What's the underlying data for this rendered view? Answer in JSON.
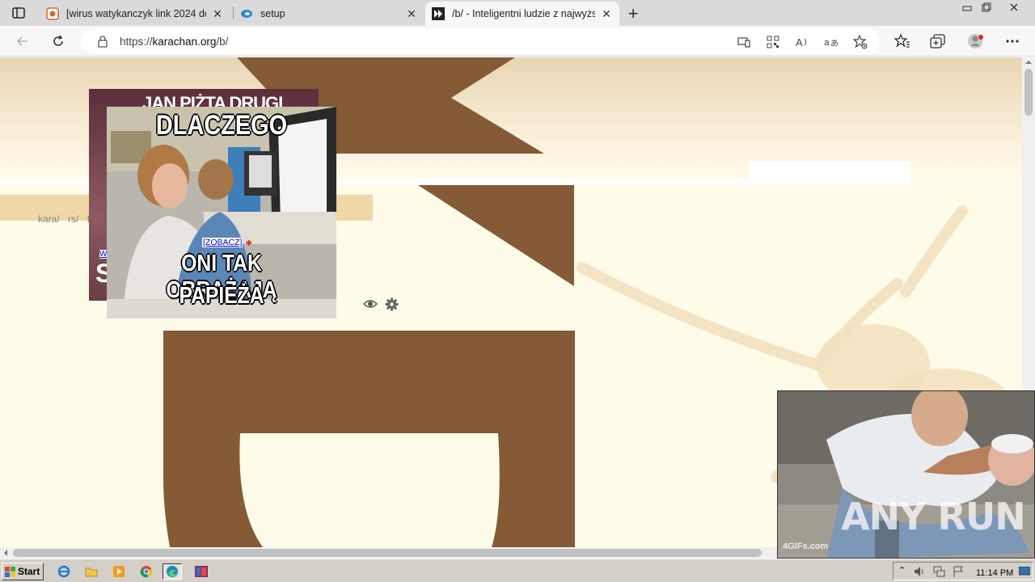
{
  "browser": {
    "tabs": [
      {
        "title": "[wirus watykanczyk link 2024 do",
        "favicon": "document-icon",
        "active": false
      },
      {
        "title": "setup",
        "favicon": "edge-icon",
        "active": false
      },
      {
        "title": "/b/ - Inteligentni ludzie z najwyżs",
        "favicon": "karachan-icon",
        "active": true
      }
    ],
    "url_prefix": "https://",
    "url_host": "karachan.org",
    "url_path": "/b/"
  },
  "page": {
    "board_links": [
      "kara/",
      "rs/",
      "f"
    ],
    "meme_back": {
      "top_text": "JAN PIŻTA DRUGI",
      "side_text": "S",
      "link": "W"
    },
    "meme_front": {
      "top_text": "DLACZEGO",
      "bottom_line1": "ONI TAK OBRAŻAJĄ",
      "bottom_line2": "PAPIEŻA"
    },
    "zobacz_link": "[ZOBACZ]",
    "video_overlay": {
      "watermark": "ANY RUN",
      "corner_text": "4GIFs.com"
    }
  },
  "taskbar": {
    "start_label": "Start",
    "clock": "11:14 PM"
  }
}
